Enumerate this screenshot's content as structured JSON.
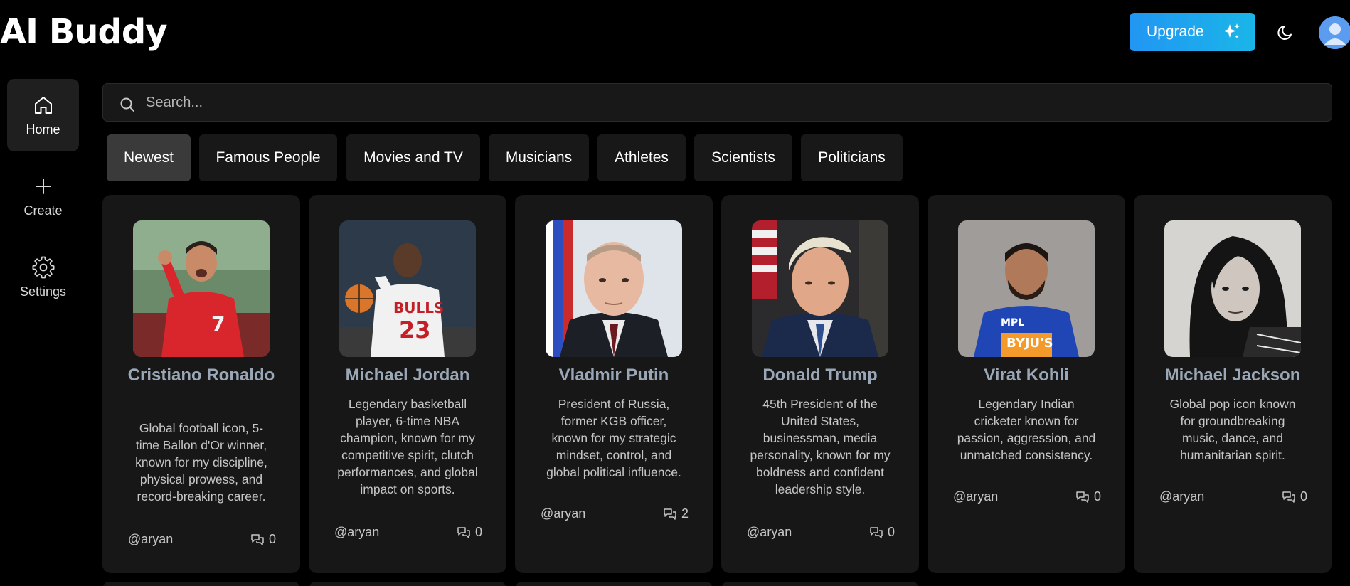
{
  "header": {
    "logo": "AI Buddy",
    "upgrade_label": "Upgrade"
  },
  "sidebar": {
    "items": [
      {
        "label": "Home",
        "icon": "home-icon",
        "active": true
      },
      {
        "label": "Create",
        "icon": "plus-icon",
        "active": false
      },
      {
        "label": "Settings",
        "icon": "gear-icon",
        "active": false
      }
    ]
  },
  "search": {
    "placeholder": "Search..."
  },
  "categories": [
    "Newest",
    "Famous People",
    "Movies and TV",
    "Musicians",
    "Athletes",
    "Scientists",
    "Politicians"
  ],
  "cards": [
    {
      "name": "Cristiano Ronaldo",
      "description": "Global football icon, 5-time Ballon d'Or winner, known for my discipline, physical prowess, and record-breaking career.",
      "author": "@aryan",
      "chats": "0"
    },
    {
      "name": "Michael Jordan",
      "description": "Legendary basketball player, 6-time NBA champion, known for my competitive spirit, clutch performances, and global impact on sports.",
      "author": "@aryan",
      "chats": "0"
    },
    {
      "name": "Vladmir Putin",
      "description": "President of Russia, former KGB officer, known for my strategic mindset, control, and global political influence.",
      "author": "@aryan",
      "chats": "2"
    },
    {
      "name": "Donald Trump",
      "description": "45th President of the United States, businessman, media personality, known for my boldness and confident leadership style.",
      "author": "@aryan",
      "chats": "0"
    },
    {
      "name": "Virat Kohli",
      "description": "Legendary Indian cricketer known for passion, aggression, and unmatched consistency.",
      "author": "@aryan",
      "chats": "0"
    },
    {
      "name": "Michael Jackson",
      "description": "Global pop icon known for groundbreaking music, dance, and humanitarian spirit.",
      "author": "@aryan",
      "chats": "0"
    }
  ],
  "colors": {
    "background": "#000000",
    "card": "#171717",
    "accent_gradient_start": "#2196f3",
    "accent_gradient_end": "#1ab6e8",
    "name_text": "#9aa7b6"
  }
}
